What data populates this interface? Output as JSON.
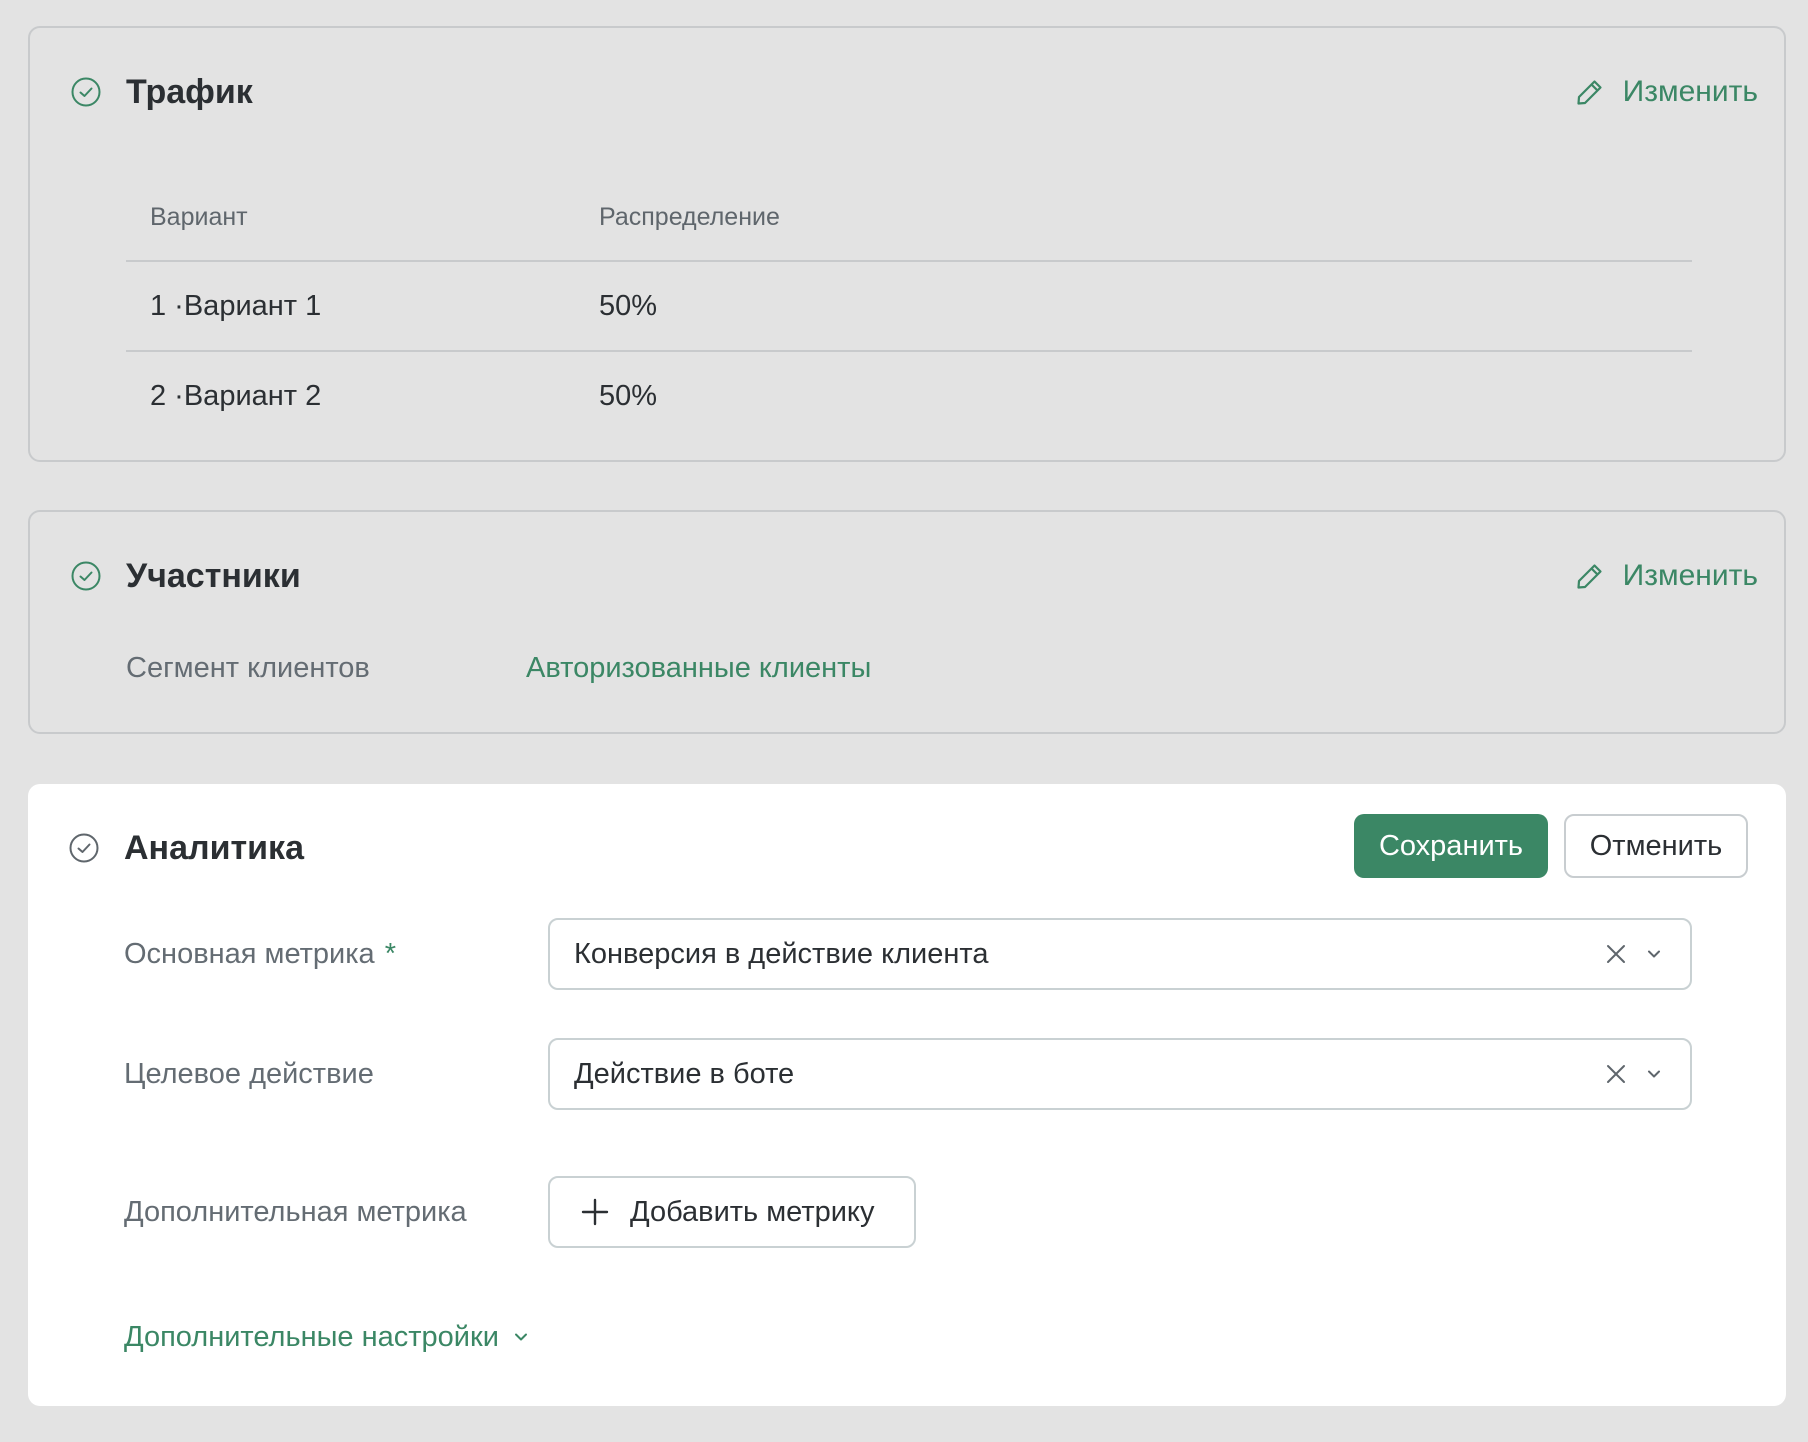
{
  "traffic": {
    "title": "Трафик",
    "edit_label": "Изменить",
    "columns": [
      "Вариант",
      "Распределение"
    ],
    "rows": [
      {
        "variant": "1 ·Вариант 1",
        "share": "50%"
      },
      {
        "variant": "2 ·Вариант 2",
        "share": "50%"
      }
    ]
  },
  "participants": {
    "title": "Участники",
    "edit_label": "Изменить",
    "segment_label": "Сегмент клиентов",
    "segment_value": "Авторизованные клиенты"
  },
  "analytics": {
    "title": "Аналитика",
    "save_label": "Сохранить",
    "cancel_label": "Отменить",
    "primary_metric_label": "Основная метрика",
    "required_mark": "*",
    "primary_metric_value": "Конверсия в действие клиента",
    "target_action_label": "Целевое действие",
    "target_action_value": "Действие в боте",
    "extra_metric_label": "Дополнительная метрика",
    "add_metric_label": "Добавить метрику",
    "more_settings_label": "Дополнительные настройки"
  },
  "colors": {
    "accent": "#3b8765",
    "background": "#e3e3e3",
    "card_white": "#ffffff",
    "text": "#2b2f33",
    "muted": "#646c73"
  },
  "icons": [
    "check-circle-icon",
    "pencil-icon",
    "clear-icon",
    "chevron-down-icon",
    "plus-icon"
  ]
}
